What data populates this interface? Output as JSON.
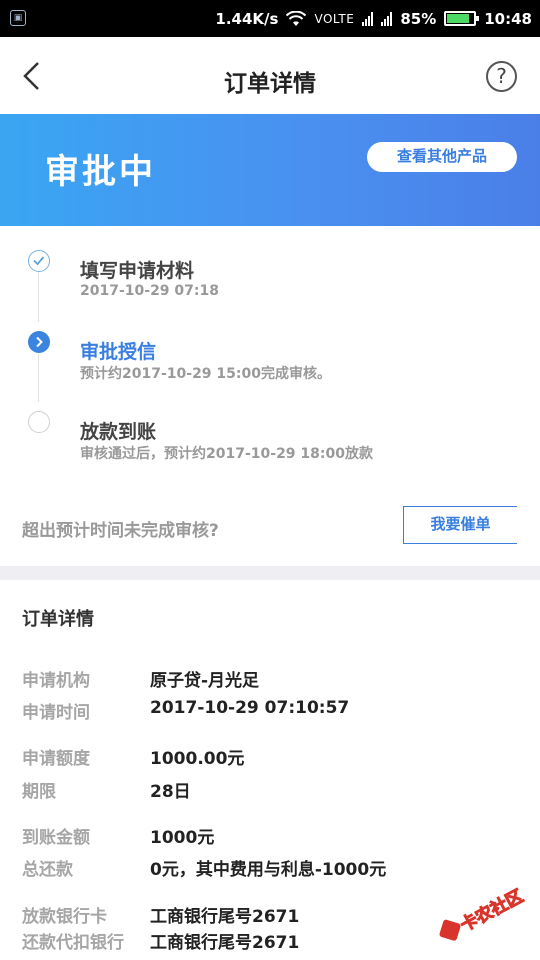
{
  "status_bar": {
    "speed": "1.44K/s",
    "network": "VOLTE",
    "battery": "85%",
    "time": "10:48"
  },
  "nav": {
    "title": "订单详情"
  },
  "banner": {
    "status": "审批中",
    "other_products_label": "查看其他产品"
  },
  "steps": [
    {
      "title": "填写申请材料",
      "subtitle": "2017-10-29  07:18",
      "state": "done"
    },
    {
      "title": "审批授信",
      "subtitle": "预计约2017-10-29  15:00完成审核。",
      "state": "active"
    },
    {
      "title": "放款到账",
      "subtitle": "审核通过后，预计约2017-10-29  18:00放款",
      "state": "pending"
    }
  ],
  "overdue_prompt": "超出预计时间未完成审核?",
  "urge_button_label": "我要催单",
  "details": {
    "title": "订单详情",
    "rows": [
      {
        "label": "申请机构",
        "value": "原子贷-月光足"
      },
      {
        "label": "申请时间",
        "value": "2017-10-29  07:10:57"
      },
      {
        "label": "申请额度",
        "value": "1000.00元"
      },
      {
        "label": "期限",
        "value": "28日"
      },
      {
        "label": "到账金额",
        "value": "1000元"
      },
      {
        "label": "总还款",
        "value": "0元，其中费用与利息-1000元"
      },
      {
        "label": "放款银行卡",
        "value": "工商银行尾号2671"
      },
      {
        "label": "还款代扣银行",
        "value": "工商银行尾号2671"
      }
    ]
  },
  "watermark": "卡农社区",
  "colors": {
    "accent": "#3a7fe0",
    "banner_start": "#3aa6f2",
    "banner_end": "#4a7fe8"
  }
}
